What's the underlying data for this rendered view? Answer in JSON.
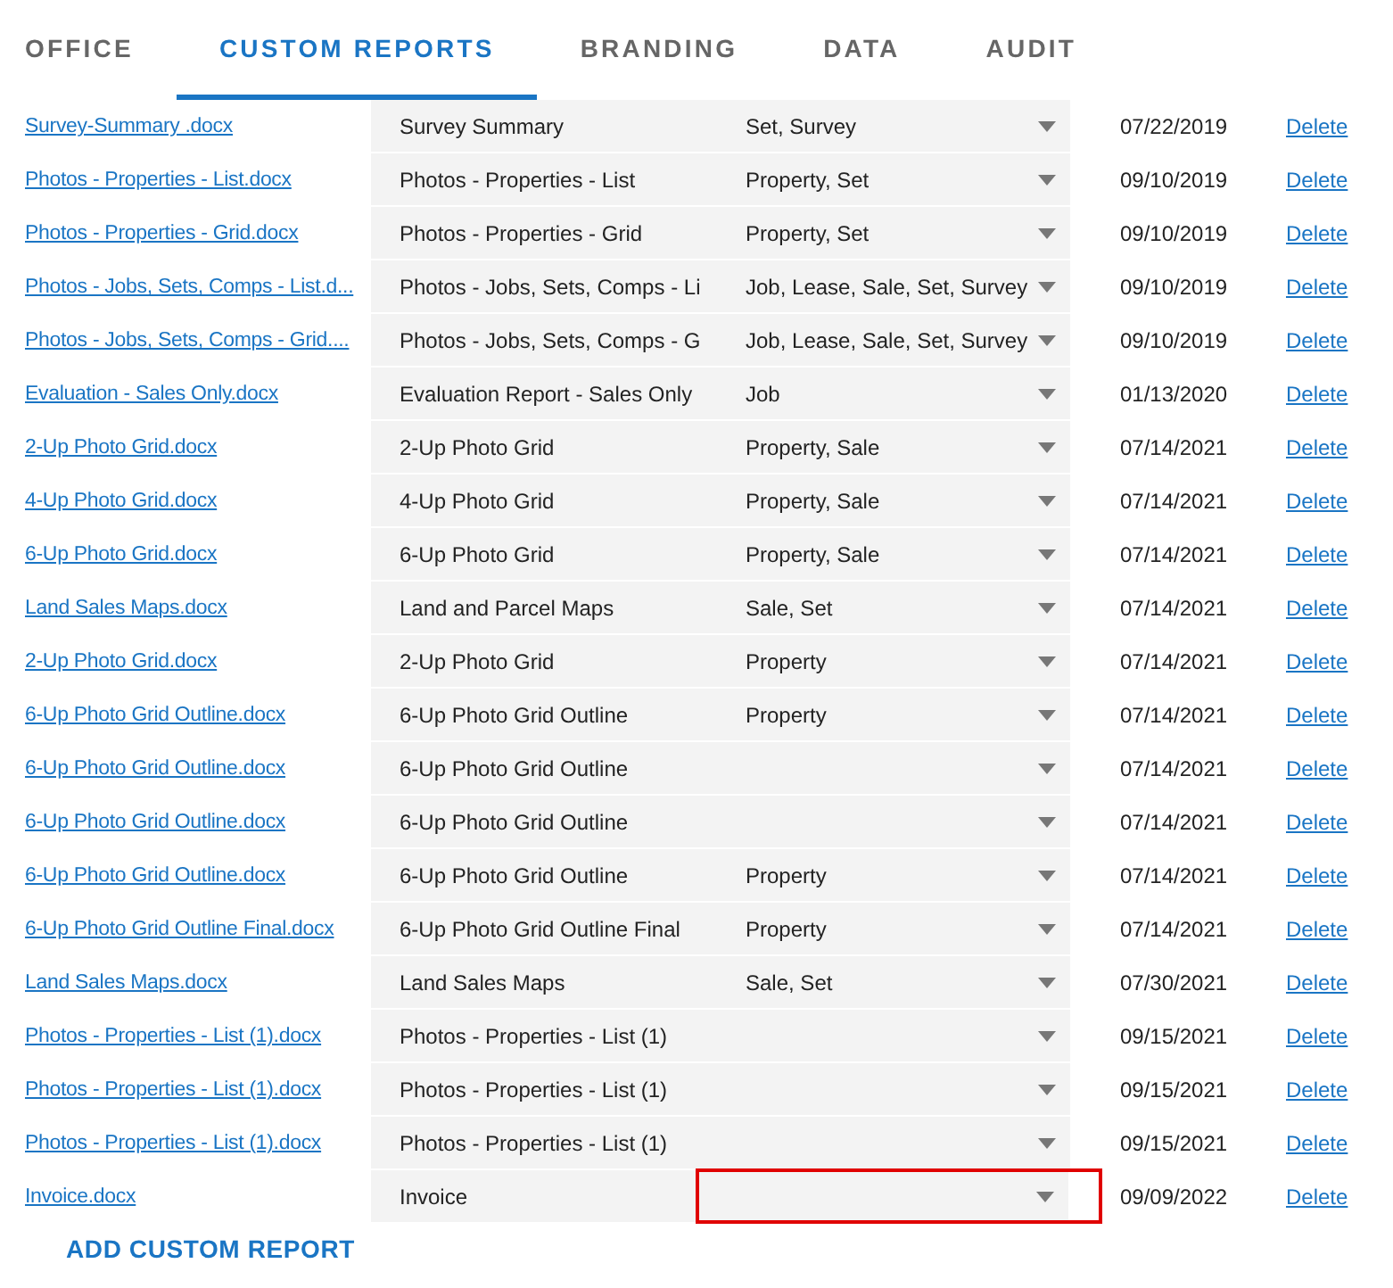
{
  "tabs": [
    {
      "label": "OFFICE",
      "selected": false
    },
    {
      "label": "CUSTOM REPORTS",
      "selected": true
    },
    {
      "label": "BRANDING",
      "selected": false
    },
    {
      "label": "DATA",
      "selected": false
    },
    {
      "label": "AUDIT",
      "selected": false
    }
  ],
  "reports": [
    {
      "file": "Survey-Summary .docx",
      "name": "Survey Summary",
      "types": "Set, Survey",
      "date": "07/22/2019",
      "action": "Delete",
      "highlighted": false
    },
    {
      "file": "Photos - Properties - List.docx",
      "name": "Photos - Properties - List",
      "types": "Property, Set",
      "date": "09/10/2019",
      "action": "Delete",
      "highlighted": false
    },
    {
      "file": "Photos - Properties - Grid.docx",
      "name": "Photos - Properties - Grid",
      "types": "Property, Set",
      "date": "09/10/2019",
      "action": "Delete",
      "highlighted": false
    },
    {
      "file": "Photos - Jobs, Sets, Comps - List.d...",
      "name": "Photos - Jobs, Sets, Comps - Li",
      "types": "Job, Lease, Sale, Set, Survey",
      "date": "09/10/2019",
      "action": "Delete",
      "highlighted": false
    },
    {
      "file": "Photos - Jobs, Sets, Comps - Grid....",
      "name": "Photos - Jobs, Sets, Comps - G",
      "types": "Job, Lease, Sale, Set, Survey",
      "date": "09/10/2019",
      "action": "Delete",
      "highlighted": false
    },
    {
      "file": "Evaluation - Sales Only.docx",
      "name": "Evaluation Report - Sales Only",
      "types": "Job",
      "date": "01/13/2020",
      "action": "Delete",
      "highlighted": false
    },
    {
      "file": "2-Up Photo Grid.docx",
      "name": "2-Up Photo Grid",
      "types": "Property, Sale",
      "date": "07/14/2021",
      "action": "Delete",
      "highlighted": false
    },
    {
      "file": "4-Up Photo Grid.docx",
      "name": "4-Up Photo Grid",
      "types": "Property, Sale",
      "date": "07/14/2021",
      "action": "Delete",
      "highlighted": false
    },
    {
      "file": "6-Up Photo Grid.docx",
      "name": "6-Up Photo Grid",
      "types": "Property, Sale",
      "date": "07/14/2021",
      "action": "Delete",
      "highlighted": false
    },
    {
      "file": "Land Sales Maps.docx",
      "name": "Land and Parcel Maps",
      "types": "Sale, Set",
      "date": "07/14/2021",
      "action": "Delete",
      "highlighted": false
    },
    {
      "file": "2-Up Photo Grid.docx",
      "name": "2-Up Photo Grid",
      "types": "Property",
      "date": "07/14/2021",
      "action": "Delete",
      "highlighted": false
    },
    {
      "file": "6-Up Photo Grid Outline.docx",
      "name": "6-Up Photo Grid Outline",
      "types": "Property",
      "date": "07/14/2021",
      "action": "Delete",
      "highlighted": false
    },
    {
      "file": "6-Up Photo Grid Outline.docx",
      "name": "6-Up Photo Grid Outline",
      "date": "07/14/2021",
      "action": "Delete",
      "highlighted": false
    },
    {
      "file": "6-Up Photo Grid Outline.docx",
      "name": "6-Up Photo Grid Outline",
      "date": "07/14/2021",
      "action": "Delete",
      "highlighted": false
    },
    {
      "file": "6-Up Photo Grid Outline.docx",
      "name": "6-Up Photo Grid Outline",
      "types": "Property",
      "date": "07/14/2021",
      "action": "Delete",
      "highlighted": false
    },
    {
      "file": "6-Up Photo Grid Outline Final.docx",
      "name": "6-Up Photo Grid Outline Final",
      "types": "Property",
      "date": "07/14/2021",
      "action": "Delete",
      "highlighted": false
    },
    {
      "file": "Land Sales Maps.docx",
      "name": "Land Sales Maps",
      "types": "Sale, Set",
      "date": "07/30/2021",
      "action": "Delete",
      "highlighted": false
    },
    {
      "file": "Photos - Properties - List (1).docx",
      "name": "Photos - Properties - List (1)",
      "date": "09/15/2021",
      "action": "Delete",
      "highlighted": false
    },
    {
      "file": "Photos - Properties - List (1).docx",
      "name": "Photos - Properties - List (1)",
      "date": "09/15/2021",
      "action": "Delete",
      "highlighted": false
    },
    {
      "file": "Photos - Properties - List (1).docx",
      "name": "Photos - Properties - List (1)",
      "date": "09/15/2021",
      "action": "Delete",
      "highlighted": false
    },
    {
      "file": "Invoice.docx",
      "name": "Invoice",
      "date": "09/09/2022",
      "action": "Delete",
      "highlighted": true
    }
  ],
  "add_button": "ADD CUSTOM REPORT"
}
